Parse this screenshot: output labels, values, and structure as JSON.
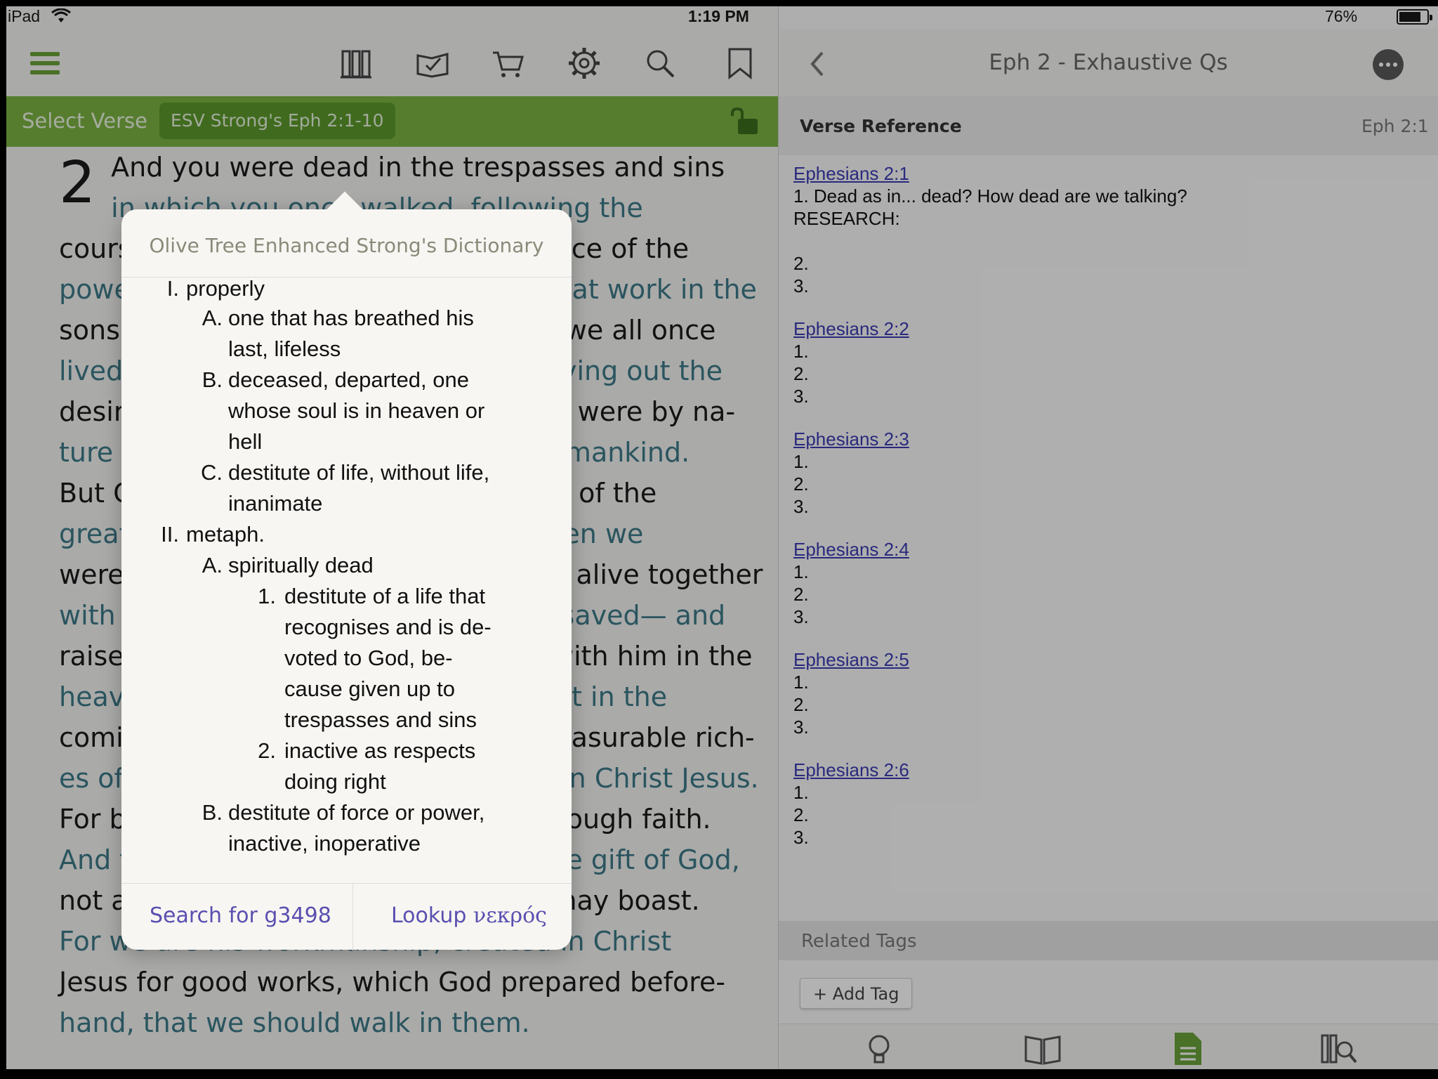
{
  "status": {
    "carrier": "iPad",
    "time": "1:19 PM",
    "battery": "76%",
    "battery_level": 0.76
  },
  "left_toolbar": {
    "icons": [
      "menu-icon",
      "library-icon",
      "reading-plan-icon",
      "store-cart-icon",
      "settings-gear-icon",
      "search-icon",
      "bookmark-icon"
    ]
  },
  "verse_bar": {
    "select_label": "Select Verse",
    "reference": "ESV Strong's Eph 2:1-10"
  },
  "bible": {
    "chapter": "2",
    "lines": [
      "And you were dead in the trespasses and sins",
      "in which you once walked, following the",
      "course of this world, following the prince of the",
      "power of the air, the spirit that is now at work in the",
      "sons of disobedience— among whom we all once",
      "lived in the passions of our flesh, carrying out the",
      "desires of the body and the mind, and were by na-",
      "ture children of wrath, like the rest of mankind.",
      "But God, being rich in mercy, because of the",
      "great love with which he loved us, when we",
      "were dead in our trespasses, made us alive together",
      "with Christ—by grace you have been saved— and",
      "raised us up with him and seated us with him in the",
      "heavenly places in Christ Jesus, so that in the",
      "coming ages he might show the immeasurable rich-",
      "es of his grace in kindness toward us in Christ Jesus.",
      "For by grace you have been saved through faith.",
      "And this is not your own doing; it is the gift of God,",
      "not a result of works, so that no one may boast.",
      "For we are his workmanship, created in Christ",
      "Jesus for good works, which God prepared before-",
      "hand, that we should walk in them."
    ]
  },
  "popover": {
    "title": "Olive Tree Enhanced Strong's Dictionary",
    "definitions": [
      {
        "num": "I.",
        "text": "properly"
      },
      {
        "num": "A.",
        "text": "one that has breathed his last, lifeless"
      },
      {
        "num": "B.",
        "text": "deceased, departed, one whose soul is in heaven or hell"
      },
      {
        "num": "C.",
        "text": "destitute of life, without life, inanimate"
      },
      {
        "num": "II.",
        "text": "metaph."
      },
      {
        "num": "A.",
        "text": "spiritually dead"
      },
      {
        "num": "1.",
        "text": "destitute of a life that recognises and is devoted to God, because given up to trespasses and sins"
      },
      {
        "num": "2.",
        "text": "inactive as respects doing right"
      },
      {
        "num": "B.",
        "text": "destitute of force or power, inactive, inoperative"
      }
    ],
    "search_label": "Search for g3498",
    "lookup_label": "Lookup",
    "lookup_word": "νεκρός"
  },
  "notes_header": {
    "title": "Eph 2 - Exhaustive Qs"
  },
  "verse_reference": {
    "label": "Verse Reference",
    "value": "Eph 2:1"
  },
  "notes": [
    {
      "heading": "Ephesians 2:1",
      "lines": [
        "1. Dead as in... dead? How dead are we talking?",
        "RESEARCH:",
        "",
        "2.",
        "3."
      ]
    },
    {
      "heading": "Ephesians 2:2",
      "lines": [
        "1.",
        "2.",
        "3."
      ]
    },
    {
      "heading": "Ephesians 2:3",
      "lines": [
        "1.",
        "2.",
        "3."
      ]
    },
    {
      "heading": "Ephesians 2:4",
      "lines": [
        "1.",
        "2.",
        "3."
      ]
    },
    {
      "heading": "Ephesians 2:5",
      "lines": [
        "1.",
        "2.",
        "3."
      ]
    },
    {
      "heading": "Ephesians 2:6",
      "lines": [
        "1.",
        "2.",
        "3."
      ]
    }
  ],
  "related_tags": {
    "label": "Related Tags",
    "add_label": "+ Add Tag"
  },
  "bottom_tabs": [
    "tips-lightbulb-icon",
    "book-resources-icon",
    "note-document-icon",
    "library-search-icon"
  ],
  "colors": {
    "accent_green": "#7bb343",
    "link_purple": "#3b3bb5",
    "popover_action": "#5a4fb0"
  }
}
